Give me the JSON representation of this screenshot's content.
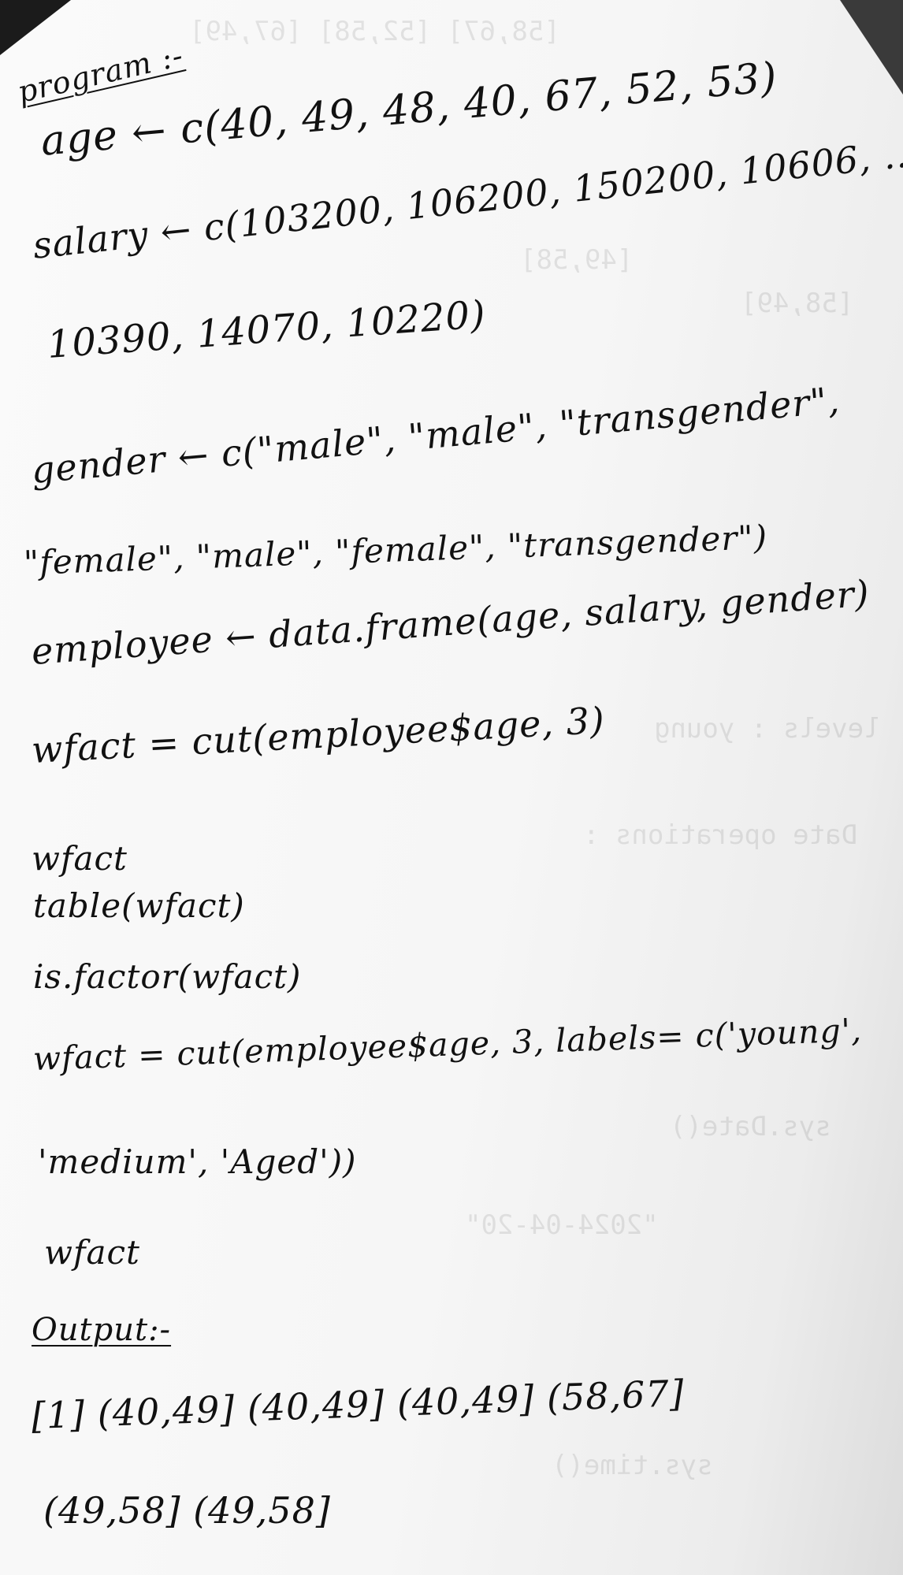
{
  "document": {
    "program_heading": "program :-",
    "code_lines": [
      "age ← c(40, 49, 48, 40, 67, 52, 53)",
      "salary ← c(103200, 106200, 150200, 10606, ...",
      "10390, 14070, 10220)",
      "gender ← c(\"male\", \"male\", \"transgender\",",
      "\"female\", \"male\", \"female\", \"transgender\")",
      "employee ← data.frame(age, salary, gender)",
      "wfact = cut(employee$age, 3)",
      "wfact",
      "table(wfact)",
      "is.factor(wfact)",
      "wfact = cut(employee$age, 3, labels= c('young',",
      "'medium', 'Aged'))",
      "wfact"
    ],
    "output_heading": "Output:-",
    "output_lines": [
      "[1]   (40,49] (40,49] (40,49] (58,67]",
      "(49,58] (49,58]"
    ],
    "bleed_through": [
      "[58,67]   [52,58]   [67,49]",
      "[49,58]",
      "[58,49]",
      "Date operations :",
      "sys.Date()",
      "\"2024-04-20\"",
      "sys.time()",
      "levels : young"
    ]
  }
}
